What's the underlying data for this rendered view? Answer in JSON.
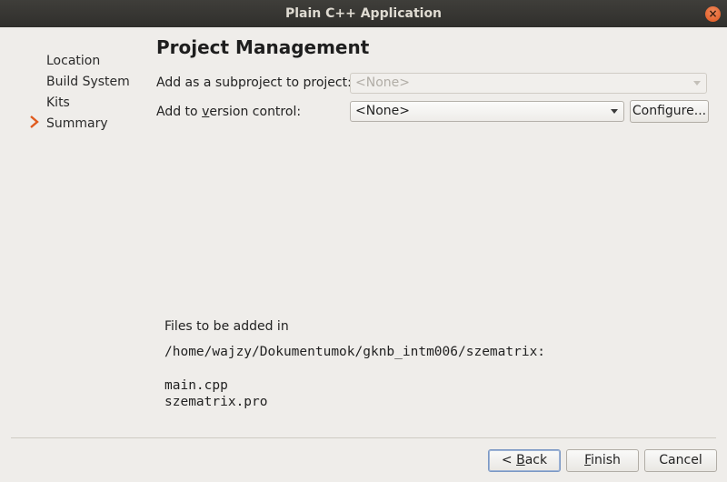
{
  "window": {
    "title": "Plain C++ Application"
  },
  "steps": [
    {
      "label": "Location"
    },
    {
      "label": "Build System"
    },
    {
      "label": "Kits"
    },
    {
      "label": "Summary",
      "current": true
    }
  ],
  "page": {
    "title": "Project Management",
    "subproject": {
      "label": "Add as a subproject to project:",
      "value": "<None>",
      "enabled": false
    },
    "version_control": {
      "label_before": "Add to ",
      "label_mnemonic": "v",
      "label_after": "ersion control:",
      "value": "<None>",
      "enabled": true
    },
    "configure_label": "Configure...",
    "files": {
      "heading": "Files to be added in",
      "directory": "/home/wajzy/Dokumentumok/gknb_intm006/szematrix:",
      "list": [
        "main.cpp",
        "szematrix.pro"
      ]
    }
  },
  "buttons": {
    "back": {
      "prefix": "< ",
      "mnemonic": "B",
      "rest": "ack"
    },
    "finish": {
      "mnemonic": "F",
      "rest": "inish"
    },
    "cancel": "Cancel"
  },
  "colors": {
    "accent_arrow": "#e05a1d",
    "titlebar": "#373633"
  },
  "icons": {
    "close": "close-icon",
    "current_step": "chevron-right-icon"
  }
}
